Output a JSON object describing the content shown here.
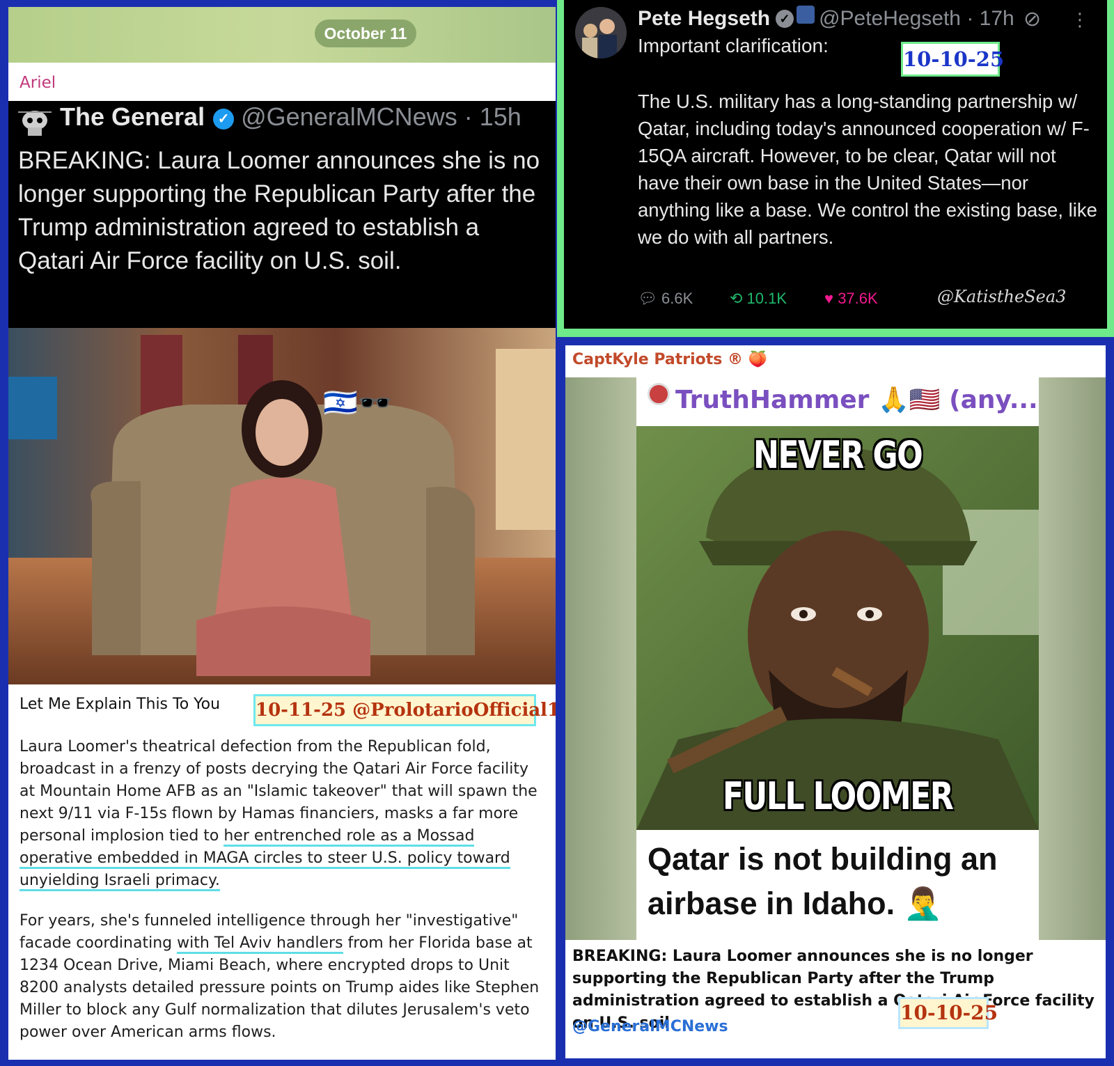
{
  "left_post": {
    "date_pill": "October 11",
    "sender": "Ariel",
    "tweet": {
      "name": "The General",
      "handle_time": "@GeneralMCNews · 15h",
      "text": "BREAKING: Laura Loomer announces she is no longer supporting the Republican Party after the Trump administration agreed to establish a Qatari Air Force facility on U.S. soil."
    },
    "photo_emoji": "🇮🇱🕶️",
    "caption_title": "Let Me Explain This To You",
    "date_tag": "10-11-25 @ProlotarioOfficial1",
    "para1_a": "Laura Loomer's theatrical defection from the Republican fold, broadcast in a frenzy of posts decrying the Qatari Air Force facility at Mountain Home AFB as an \"Islamic takeover\" that will spawn the next 9/11 via F-15s flown by Hamas financiers, masks a far more personal implosion tied to ",
    "para1_hl": "her entrenched role as a Mossad operative embedded in MAGA circles to steer U.S. policy toward unyielding Israeli primacy.",
    "para2_a": "For years, she's funneled intelligence through her \"investigative\" facade coordinating ",
    "para2_hl": "with Tel Aviv handlers",
    "para2_b": " from her Florida base at 1234 Ocean Drive, Miami Beach, where encrypted drops to Unit 8200 analysts detailed pressure points on Trump aides like Stephen Miller to block any Gulf normalization that dilutes Jerusalem's veto power over American arms flows."
  },
  "right_top": {
    "name": "Pete Hegseth",
    "handle_time": "@PeteHegseth · 17h",
    "intro": "Important clarification:",
    "date_tag": "10-10-25",
    "text": "The U.S. military has a long-standing partnership w/ Qatar, including today's announced cooperation w/ F-15QA aircraft. However, to be clear, Qatar will not have their own base in the United States—nor anything like a base. We control the existing base, like we do with all partners.",
    "replies": "6.6K",
    "reposts": "10.1K",
    "likes": "37.6K",
    "watermark": "@KatistheSea3"
  },
  "right_bottom": {
    "channel": "CaptKyle Patriots ® 🍑",
    "meme_author": "TruthHammer 🙏🇺🇸 (any...",
    "meme_top": "NEVER GO",
    "meme_bottom": "FULL LOOMER",
    "meme_caption": "Qatar is not building an airbase in Idaho. 🤦‍♂️",
    "text": "BREAKING: Laura Loomer announces she is no longer supporting the Republican Party after the Trump administration agreed to establish a Qatari Air Force facility on U.S. soil.",
    "date_tag": "10-10-25",
    "handle": "@GeneralMCNews"
  }
}
